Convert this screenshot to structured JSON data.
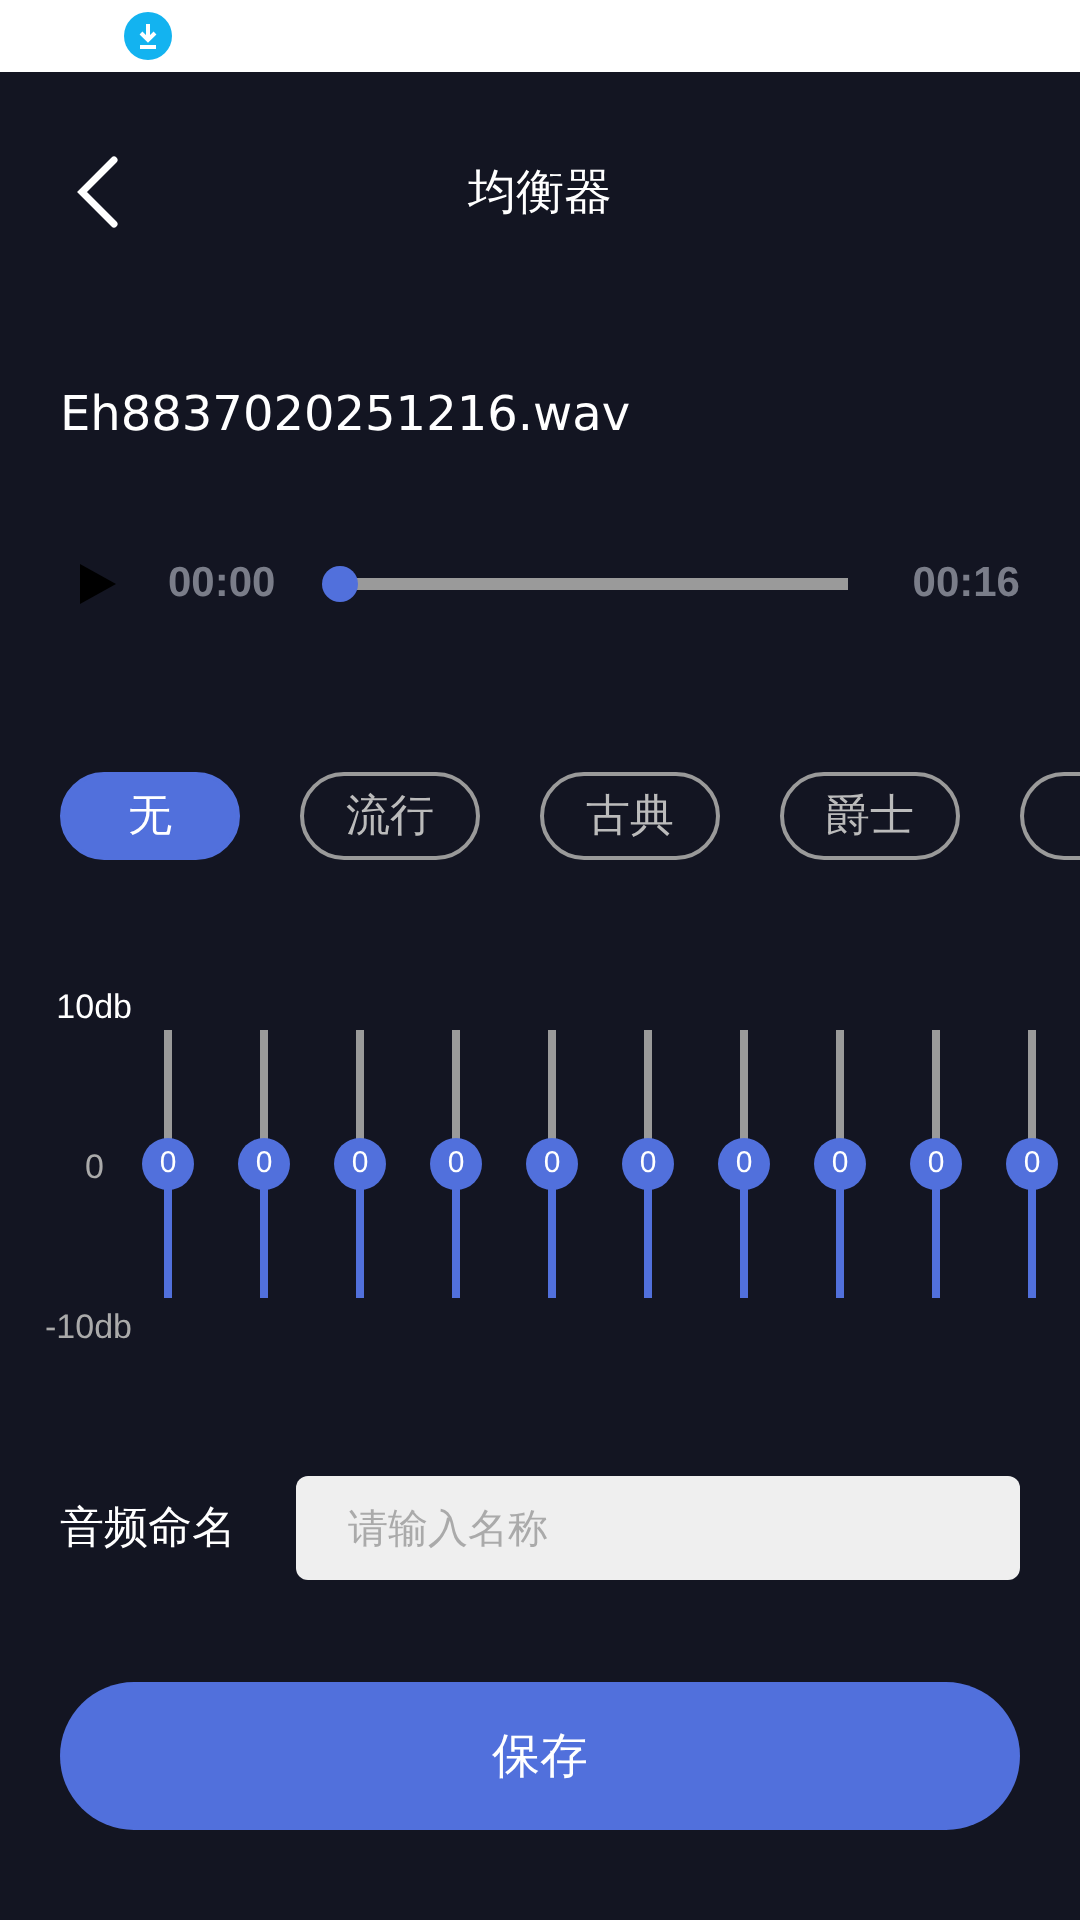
{
  "header": {
    "title": "均衡器"
  },
  "file_name": "Eh8837020251216.wav",
  "player": {
    "current": "00:00",
    "level": 0.0,
    "total": "00:16"
  },
  "presets": [
    {
      "label": "无",
      "selected": true
    },
    {
      "label": "流行",
      "selected": false
    },
    {
      "label": "古典",
      "selected": false
    },
    {
      "label": "爵士",
      "selected": false
    }
  ],
  "more_presets_cut": true,
  "equalizer": {
    "max_label": "10db",
    "zero_label": "0",
    "min_label": "-10db",
    "bands": [
      {
        "level": 0.5,
        "value": "0"
      },
      {
        "level": 0.5,
        "value": "0"
      },
      {
        "level": 0.5,
        "value": "0"
      },
      {
        "level": 0.5,
        "value": "0"
      },
      {
        "level": 0.5,
        "value": "0"
      },
      {
        "level": 0.5,
        "value": "0"
      },
      {
        "level": 0.5,
        "value": "0"
      },
      {
        "level": 0.5,
        "value": "0"
      },
      {
        "level": 0.5,
        "value": "0"
      },
      {
        "level": 0.5,
        "value": "0"
      }
    ]
  },
  "name_field": {
    "label": "音频命名",
    "placeholder": "请输入名称"
  },
  "save_button": "保存"
}
